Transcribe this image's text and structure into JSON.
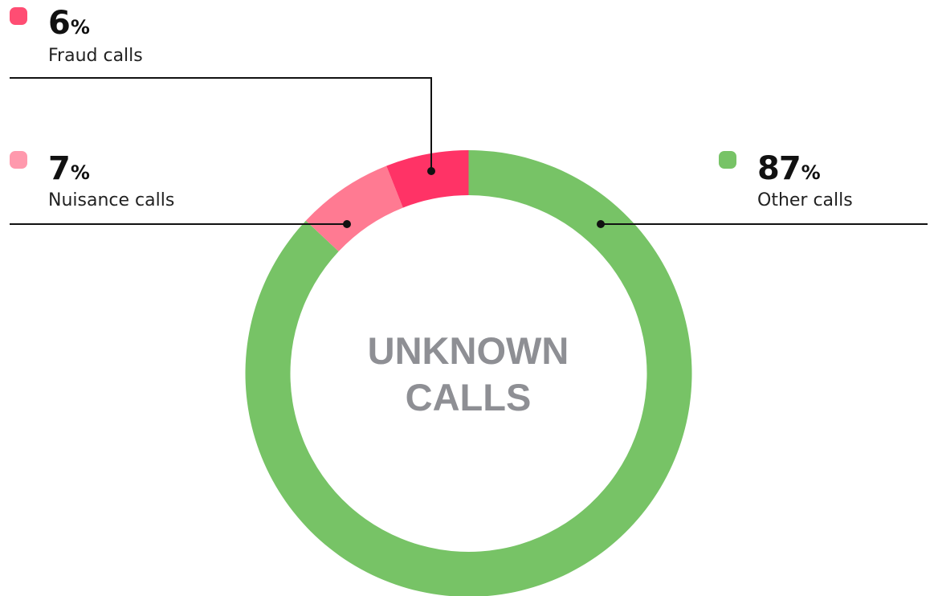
{
  "colors": {
    "other": "#77c366",
    "fraud": "#ff3366",
    "nuisance": "#ff7a92",
    "fraud_swatch": "#ff4d73",
    "nuisance_swatch": "#ff99ad",
    "center_text": "#8e8f94",
    "leader_line": "#111111"
  },
  "center_label": {
    "line1": "UNKNOWN",
    "line2": "CALLS"
  },
  "legend": {
    "fraud": {
      "value": "6",
      "unit": "%",
      "label": "Fraud calls"
    },
    "nuisance": {
      "value": "7",
      "unit": "%",
      "label": "Nuisance calls"
    },
    "other": {
      "value": "87",
      "unit": "%",
      "label": "Other calls"
    }
  },
  "chart_data": {
    "type": "pie",
    "variant": "donut",
    "title": "UNKNOWN CALLS",
    "unit": "%",
    "start": "top",
    "direction": "clockwise",
    "categories": [
      "Other calls",
      "Nuisance calls",
      "Fraud calls"
    ],
    "values": [
      87,
      7,
      6
    ],
    "colors": [
      "#77c366",
      "#ff7a92",
      "#ff3366"
    ],
    "legend": "callouts"
  }
}
